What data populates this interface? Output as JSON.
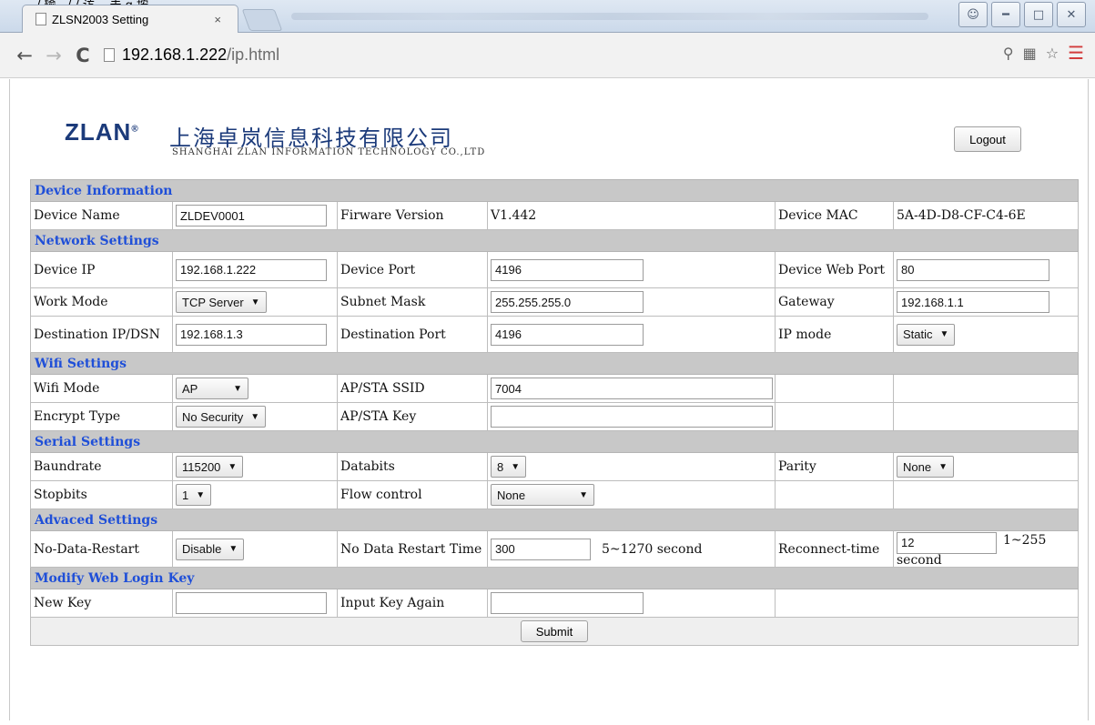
{
  "window": {
    "caption": "/ 输.../ / 访... 击 g 按..."
  },
  "tab": {
    "title": "ZLSN2003 Setting",
    "close": "×"
  },
  "url": {
    "host": "192.168.1.222",
    "path": "/ip.html"
  },
  "header": {
    "logo": "ZLAN",
    "company_cn": "上海卓岚信息科技有限公司",
    "company_en": "SHANGHAI ZLAN INFORMATION TECHNOLOGY CO.,LTD",
    "logout": "Logout"
  },
  "device_info": {
    "title": "Device Information",
    "name_label": "Device Name",
    "name_value": "ZLDEV0001",
    "fw_label": "Firware Version",
    "fw_value": "V1.442",
    "mac_label": "Device MAC",
    "mac_value": "5A-4D-D8-CF-C4-6E"
  },
  "network": {
    "title": "Network Settings",
    "ip_label": "Device IP",
    "ip_value": "192.168.1.222",
    "port_label": "Device Port",
    "port_value": "4196",
    "webport_label": "Device Web Port",
    "webport_value": "80",
    "mode_label": "Work Mode",
    "mode_value": "TCP Server",
    "mask_label": "Subnet Mask",
    "mask_value": "255.255.255.0",
    "gw_label": "Gateway",
    "gw_value": "192.168.1.1",
    "dest_label": "Destination IP/DSN",
    "dest_value": "192.168.1.3",
    "dport_label": "Destination Port",
    "dport_value": "4196",
    "ipmode_label": "IP mode",
    "ipmode_value": "Static"
  },
  "wifi": {
    "title": "Wifi Settings",
    "mode_label": "Wifi Mode",
    "mode_value": "AP",
    "ssid_label": "AP/STA SSID",
    "ssid_value": "7004",
    "enc_label": "Encrypt Type",
    "enc_value": "No Security",
    "key_label": "AP/STA Key",
    "key_value": ""
  },
  "serial": {
    "title": "Serial Settings",
    "baud_label": "Baundrate",
    "baud_value": "115200",
    "data_label": "Databits",
    "data_value": "8",
    "parity_label": "Parity",
    "parity_value": "None",
    "stop_label": "Stopbits",
    "stop_value": "1",
    "flow_label": "Flow control",
    "flow_value": "None"
  },
  "advanced": {
    "title": "Advaced Settings",
    "ndr_label": "No-Data-Restart",
    "ndr_value": "Disable",
    "ndrt_label": "No Data Restart Time",
    "ndrt_value": "300",
    "ndrt_range": "5~1270 second",
    "rc_label": "Reconnect-time",
    "rc_value": "12",
    "rc_range": "1~255",
    "rc_unit": "second"
  },
  "loginkey": {
    "title": "Modify Web Login Key",
    "new_label": "New Key",
    "new_value": "",
    "again_label": "Input Key Again",
    "again_value": ""
  },
  "submit": "Submit"
}
